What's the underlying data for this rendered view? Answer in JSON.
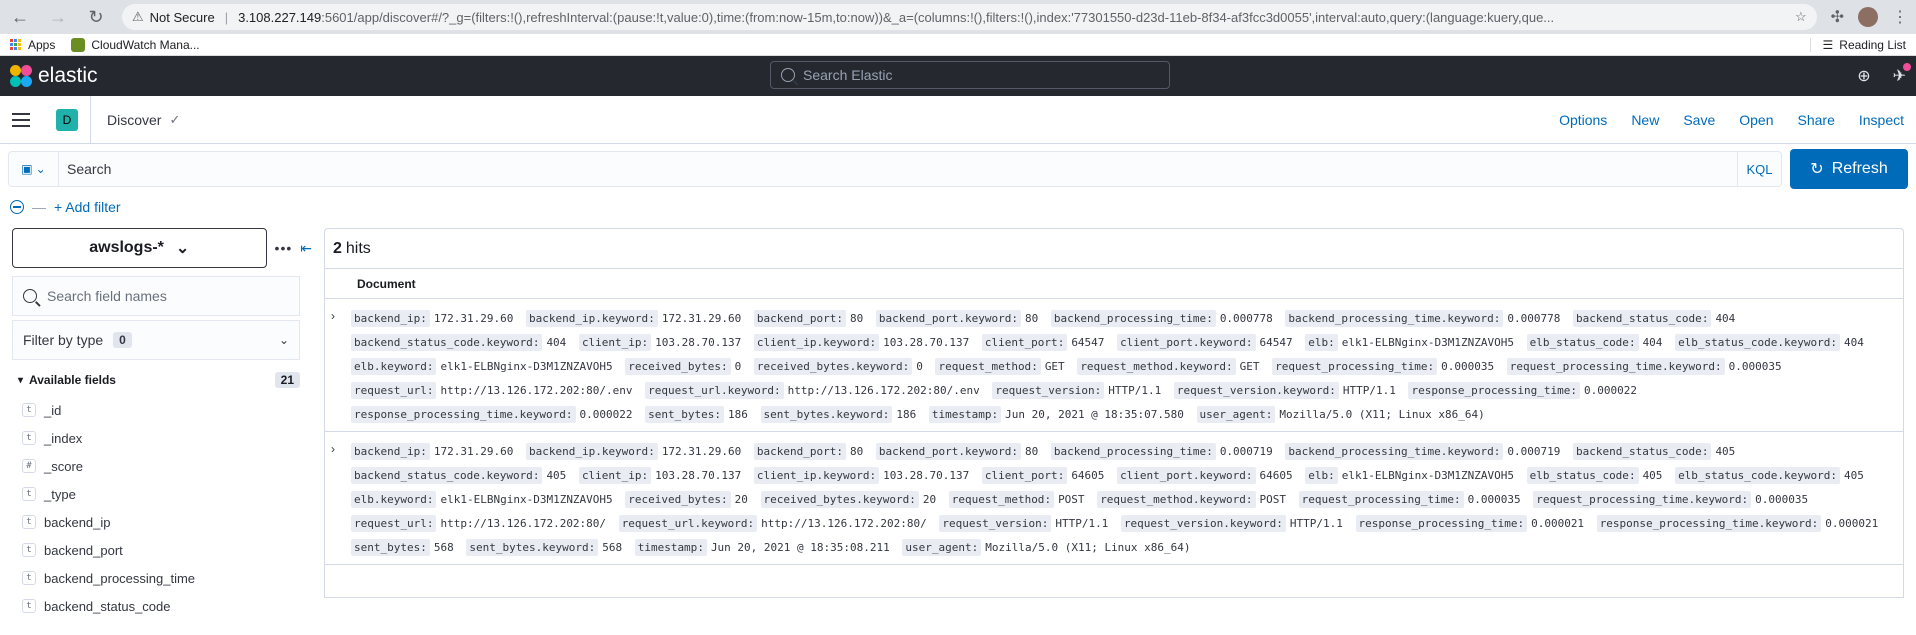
{
  "browser": {
    "security": "Not Secure",
    "url_host": "3.108.227.149",
    "url_rest": ":5601/app/discover#/?_g=(filters:!(),refreshInterval:(pause:!t,value:0),time:(from:now-15m,to:now))&_a=(columns:!(),filters:!(),index:'77301550-d23d-11eb-8f34-af3fcc3d0055',interval:auto,query:(language:kuery,que...",
    "bookmarks": [
      "Apps",
      "CloudWatch Mana..."
    ],
    "reading_list": "Reading List"
  },
  "header": {
    "brand": "elastic",
    "search_placeholder": "Search Elastic"
  },
  "app_bar": {
    "space_initial": "D",
    "title": "Discover",
    "menu": [
      "Options",
      "New",
      "Save",
      "Open",
      "Share",
      "Inspect"
    ]
  },
  "query": {
    "placeholder": "Search",
    "language": "KQL",
    "refresh_label": "Refresh",
    "add_filter": "+ Add filter"
  },
  "sidebar": {
    "index_pattern": "awslogs-*",
    "field_search_placeholder": "Search field names",
    "filter_by_type": "Filter by type",
    "filter_count": "0",
    "available_fields_label": "Available fields",
    "available_fields_count": "21",
    "fields": [
      {
        "type": "t",
        "name": "_id"
      },
      {
        "type": "t",
        "name": "_index"
      },
      {
        "type": "#",
        "name": "_score"
      },
      {
        "type": "t",
        "name": "_type"
      },
      {
        "type": "t",
        "name": "backend_ip"
      },
      {
        "type": "t",
        "name": "backend_port"
      },
      {
        "type": "t",
        "name": "backend_processing_time"
      },
      {
        "type": "t",
        "name": "backend_status_code"
      }
    ]
  },
  "results": {
    "hits_count": "2",
    "hits_label": "hits",
    "column_header": "Document",
    "documents": [
      [
        [
          "backend_ip",
          "172.31.29.60"
        ],
        [
          "backend_ip.keyword",
          "172.31.29.60"
        ],
        [
          "backend_port",
          "80"
        ],
        [
          "backend_port.keyword",
          "80"
        ],
        [
          "backend_processing_time",
          "0.000778"
        ],
        [
          "backend_processing_time.keyword",
          "0.000778"
        ],
        [
          "backend_status_code",
          "404"
        ],
        [
          "backend_status_code.keyword",
          "404"
        ],
        [
          "client_ip",
          "103.28.70.137"
        ],
        [
          "client_ip.keyword",
          "103.28.70.137"
        ],
        [
          "client_port",
          "64547"
        ],
        [
          "client_port.keyword",
          "64547"
        ],
        [
          "elb",
          "elk1-ELBNginx-D3M1ZNZAVOH5"
        ],
        [
          "elb_status_code",
          "404"
        ],
        [
          "elb_status_code.keyword",
          "404"
        ],
        [
          "elb.keyword",
          "elk1-ELBNginx-D3M1ZNZAVOH5"
        ],
        [
          "received_bytes",
          "0"
        ],
        [
          "received_bytes.keyword",
          "0"
        ],
        [
          "request_method",
          "GET"
        ],
        [
          "request_method.keyword",
          "GET"
        ],
        [
          "request_processing_time",
          "0.000035"
        ],
        [
          "request_processing_time.keyword",
          "0.000035"
        ],
        [
          "request_url",
          "http://13.126.172.202:80/.env"
        ],
        [
          "request_url.keyword",
          "http://13.126.172.202:80/.env"
        ],
        [
          "request_version",
          "HTTP/1.1"
        ],
        [
          "request_version.keyword",
          "HTTP/1.1"
        ],
        [
          "response_processing_time",
          "0.000022"
        ],
        [
          "response_processing_time.keyword",
          "0.000022"
        ],
        [
          "sent_bytes",
          "186"
        ],
        [
          "sent_bytes.keyword",
          "186"
        ],
        [
          "timestamp",
          "Jun 20, 2021 @ 18:35:07.580"
        ],
        [
          "user_agent",
          "Mozilla/5.0 (X11; Linux x86_64)"
        ]
      ],
      [
        [
          "backend_ip",
          "172.31.29.60"
        ],
        [
          "backend_ip.keyword",
          "172.31.29.60"
        ],
        [
          "backend_port",
          "80"
        ],
        [
          "backend_port.keyword",
          "80"
        ],
        [
          "backend_processing_time",
          "0.000719"
        ],
        [
          "backend_processing_time.keyword",
          "0.000719"
        ],
        [
          "backend_status_code",
          "405"
        ],
        [
          "backend_status_code.keyword",
          "405"
        ],
        [
          "client_ip",
          "103.28.70.137"
        ],
        [
          "client_ip.keyword",
          "103.28.70.137"
        ],
        [
          "client_port",
          "64605"
        ],
        [
          "client_port.keyword",
          "64605"
        ],
        [
          "elb",
          "elk1-ELBNginx-D3M1ZNZAVOH5"
        ],
        [
          "elb_status_code",
          "405"
        ],
        [
          "elb_status_code.keyword",
          "405"
        ],
        [
          "elb.keyword",
          "elk1-ELBNginx-D3M1ZNZAVOH5"
        ],
        [
          "received_bytes",
          "20"
        ],
        [
          "received_bytes.keyword",
          "20"
        ],
        [
          "request_method",
          "POST"
        ],
        [
          "request_method.keyword",
          "POST"
        ],
        [
          "request_processing_time",
          "0.000035"
        ],
        [
          "request_processing_time.keyword",
          "0.000035"
        ],
        [
          "request_url",
          "http://13.126.172.202:80/"
        ],
        [
          "request_url.keyword",
          "http://13.126.172.202:80/"
        ],
        [
          "request_version",
          "HTTP/1.1"
        ],
        [
          "request_version.keyword",
          "HTTP/1.1"
        ],
        [
          "response_processing_time",
          "0.000021"
        ],
        [
          "response_processing_time.keyword",
          "0.000021"
        ],
        [
          "sent_bytes",
          "568"
        ],
        [
          "sent_bytes.keyword",
          "568"
        ],
        [
          "timestamp",
          "Jun 20, 2021 @ 18:35:08.211"
        ],
        [
          "user_agent",
          "Mozilla/5.0 (X11; Linux x86_64)"
        ]
      ]
    ]
  },
  "colors": {
    "accent": "#006bb8",
    "header_bg": "#25282f",
    "space_badge": "#20b2aa"
  }
}
